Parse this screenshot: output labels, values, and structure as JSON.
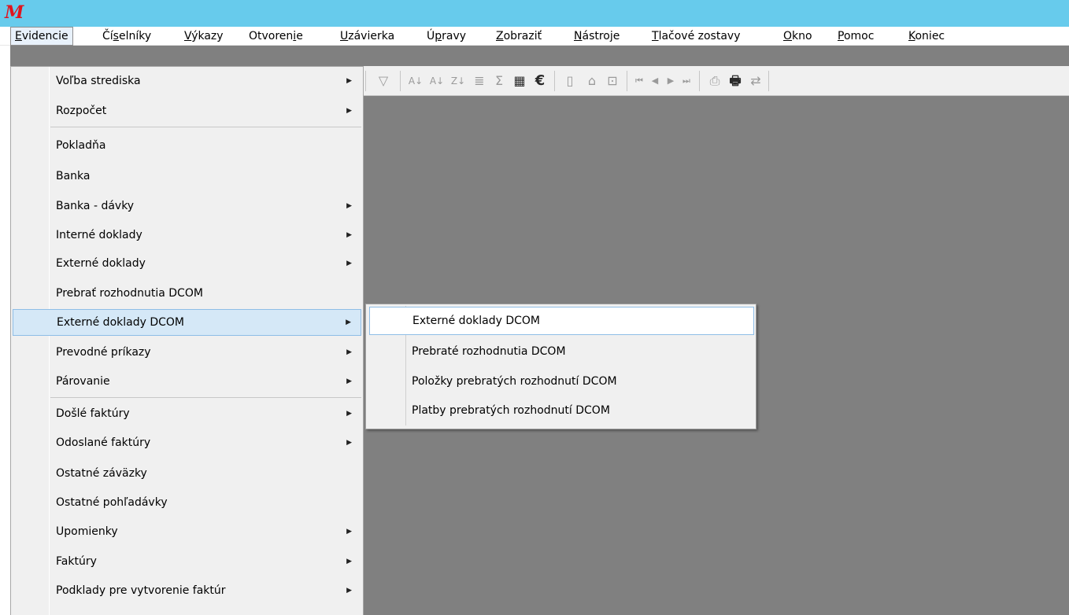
{
  "app": {
    "logo": "M"
  },
  "menubar": {
    "items": [
      {
        "pre": "",
        "ul": "E",
        "post": "videncie"
      },
      {
        "pre": "Čí",
        "ul": "s",
        "post": "elníky"
      },
      {
        "pre": "",
        "ul": "V",
        "post": "ýkazy"
      },
      {
        "pre": "Otvoren",
        "ul": "i",
        "post": "e"
      },
      {
        "pre": "",
        "ul": "U",
        "post": "závierka"
      },
      {
        "pre": "Ú",
        "ul": "p",
        "post": "ravy"
      },
      {
        "pre": "",
        "ul": "Z",
        "post": "obraziť"
      },
      {
        "pre": "",
        "ul": "N",
        "post": "ástroje"
      },
      {
        "pre": "",
        "ul": "T",
        "post": "lačové zostavy"
      },
      {
        "pre": "",
        "ul": "O",
        "post": "kno"
      },
      {
        "pre": "",
        "ul": "P",
        "post": "omoc"
      },
      {
        "pre": "",
        "ul": "K",
        "post": "oniec"
      }
    ]
  },
  "toolbar": {
    "icons": [
      "filter-icon",
      "sort-az-icon",
      "sort-az-down-icon",
      "sort-za-icon",
      "list-icon",
      "sum-icon",
      "calculator-icon",
      "euro-icon",
      "clipboard-icon",
      "insert-icon",
      "properties-icon",
      "first-record-icon",
      "prev-record-icon",
      "next-record-icon",
      "last-record-icon",
      "print-preview-icon",
      "print-icon",
      "export-icon"
    ],
    "glyphs": {
      "filter": "▽",
      "sort_az": "A↓",
      "sort_az2": "A↓",
      "sort_za": "Z↓",
      "list": "≣",
      "sum": "Σ",
      "calc": "▦",
      "euro": "€",
      "clip": "▯",
      "insert": "⌂",
      "props": "⊡",
      "first": "⏮",
      "prev": "◀",
      "next": "▶",
      "last": "⏭",
      "preview": "⎙",
      "print": "🖶",
      "export": "⇄"
    }
  },
  "main_menu": {
    "items": [
      {
        "label": "Voľba strediska",
        "arrow": "▶"
      },
      {
        "label": "Rozpočet",
        "arrow": "▶"
      },
      {
        "label": "Pokladňa",
        "arrow": ""
      },
      {
        "label": "Banka",
        "arrow": ""
      },
      {
        "label": "Banka - dávky",
        "arrow": "▶"
      },
      {
        "label": "Interné doklady",
        "arrow": "▶"
      },
      {
        "label": "Externé doklady",
        "arrow": "▶"
      },
      {
        "label": "Prebrať rozhodnutia DCOM",
        "arrow": ""
      },
      {
        "label": "Externé doklady DCOM",
        "arrow": "▶"
      },
      {
        "label": "Prevodné príkazy",
        "arrow": "▶"
      },
      {
        "label": "Párovanie",
        "arrow": "▶"
      },
      {
        "label": "Došlé faktúry",
        "arrow": "▶"
      },
      {
        "label": "Odoslané faktúry",
        "arrow": "▶"
      },
      {
        "label": "Ostatné záväzky",
        "arrow": ""
      },
      {
        "label": "Ostatné pohľadávky",
        "arrow": ""
      },
      {
        "label": "Upomienky",
        "arrow": "▶"
      },
      {
        "label": "Faktúry",
        "arrow": "▶"
      },
      {
        "label": "Podklady pre vytvorenie faktúr",
        "arrow": "▶"
      }
    ]
  },
  "sub_menu": {
    "items": [
      {
        "label": "Externé doklady DCOM"
      },
      {
        "label": "Prebraté rozhodnutia DCOM"
      },
      {
        "label": "Položky prebratých rozhodnutí DCOM"
      },
      {
        "label": "Platby prebratých rozhodnutí DCOM"
      }
    ]
  }
}
